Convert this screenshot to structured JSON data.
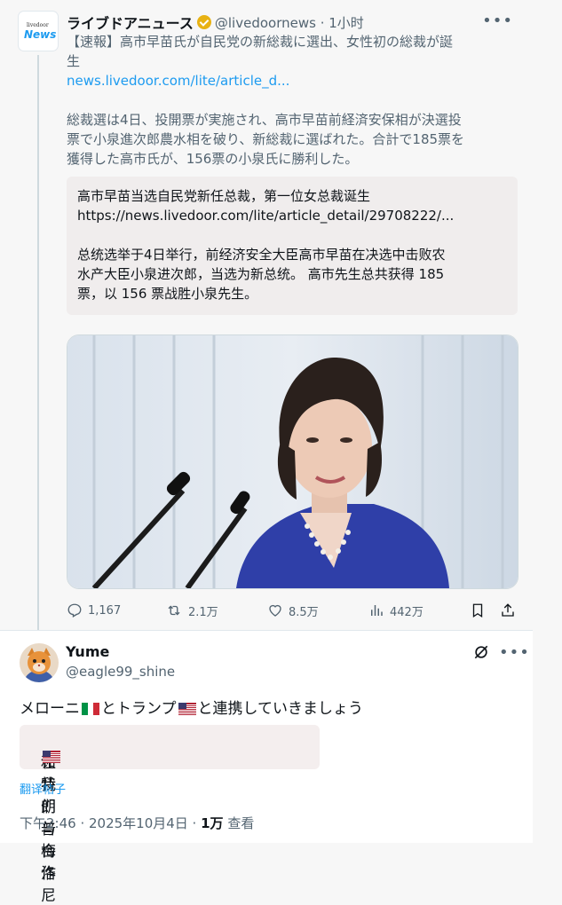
{
  "tweet": {
    "logo_small": "livedoor",
    "logo_news": "News",
    "author_name": "ライブドアニュース",
    "handle_time": "@livedoornews · 1小时",
    "text_line1": "【速報】高市早苗氏が自民党の新総裁に選出、女性初の総裁が誕",
    "text_line2": "生",
    "link": "news.livedoor.com/lite/article_d...",
    "body_line1": "総裁選は4日、投開票が実施され、高市早苗前経済安保相が決選投",
    "body_line2": "票で小泉進次郎農水相を破り、新総裁に選ばれた。合計で185票を",
    "body_line3": "獲得した高市氏が、156票の小泉氏に勝利した。",
    "translation": {
      "line1": "高市早苗当选自民党新任总裁，第一位女总裁诞生",
      "line2": "https://news.livedoor.com/lite/article_detail/29708222/...",
      "line3": "总统选举于4日举行，前经济安全大臣高市早苗在决选中击败农",
      "line4": "水产大臣小泉进次郎，当选为新总统。 高市先生总共获得 185",
      "line5": "票，以 156 票战胜小泉先生。"
    },
    "actions": {
      "replies": "1,167",
      "retweets": "2.1万",
      "likes": "8.5万",
      "views": "442万"
    }
  },
  "reply": {
    "name": "Yume",
    "handle": "@eagle99_shine",
    "text_a": "メローニ",
    "text_b": "とトランプ",
    "text_c": "と連携していきましょう",
    "translation_a": "让我们与梅洛尼 ",
    "translation_b": " 和特朗普合作 ",
    "translate_link": "翻译帖子",
    "time": "下午2:46 · 2025年10月4日 · ",
    "views_count": "1万",
    "views_label": " 查看"
  },
  "colors": {
    "accent": "#1d9bf0",
    "muted": "#536471",
    "verified": "#e8b213"
  },
  "icons": [
    "more-icon",
    "verified-icon",
    "reply-icon",
    "retweet-icon",
    "like-icon",
    "views-icon",
    "bookmark-icon",
    "share-icon",
    "grok-icon",
    "italy-flag-icon",
    "usa-flag-icon"
  ]
}
